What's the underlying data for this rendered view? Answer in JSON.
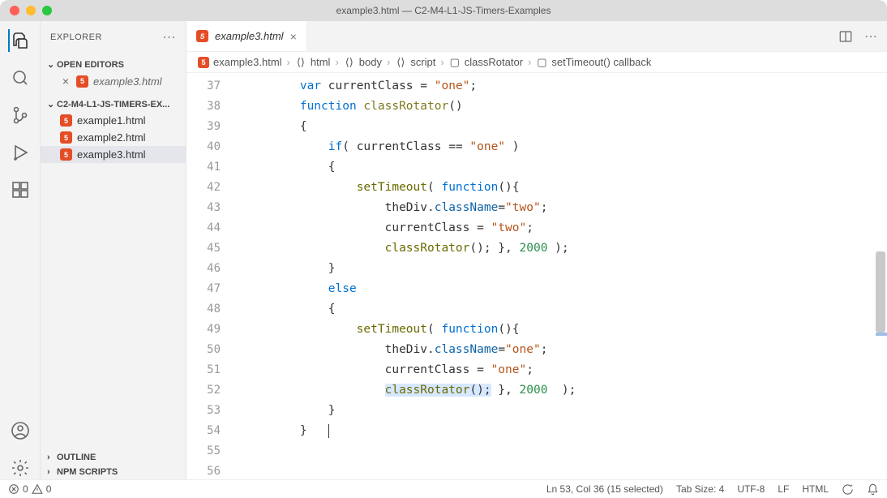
{
  "window": {
    "title": "example3.html — C2-M4-L1-JS-Timers-Examples"
  },
  "sidebar": {
    "title": "EXPLORER",
    "openEditors": {
      "label": "OPEN EDITORS",
      "items": [
        {
          "name": "example3.html"
        }
      ]
    },
    "folder": {
      "label": "C2-M4-L1-JS-TIMERS-EX...",
      "items": [
        {
          "name": "example1.html"
        },
        {
          "name": "example2.html"
        },
        {
          "name": "example3.html"
        }
      ]
    },
    "outline": {
      "label": "OUTLINE"
    },
    "npm": {
      "label": "NPM SCRIPTS"
    }
  },
  "tab": {
    "name": "example3.html"
  },
  "breadcrumb": {
    "file": "example3.html",
    "segs": [
      "html",
      "body",
      "script",
      "classRotator",
      "setTimeout() callback"
    ]
  },
  "code": {
    "startLine": 37,
    "tokens": {
      "var": "var",
      "currentClass": "currentClass",
      "eq": " = ",
      "one": "\"one\"",
      "semi": ";",
      "function": "function",
      "classRotator": "classRotator",
      "paren": "()",
      "ob": "{",
      "cb": "}",
      "if": "if",
      "lp": "( ",
      "cc": "currentClass",
      "eqeq": " == ",
      "rp": " )",
      "setTimeout": "setTimeout",
      "func": "function",
      "lpf": "(){",
      "theDiv": "theDiv",
      "dot": ".",
      "className": "className",
      "eqs": "=",
      "two": "\"two\"",
      "assign": " = ",
      "crcall": "classRotator",
      "callp": "(); },",
      "sp": " ",
      "num": "2000",
      "tail": " );",
      "else": "else",
      "tail2": "  );"
    }
  },
  "status": {
    "errors": "0",
    "warnings": "0",
    "pos": "Ln 53, Col 36 (15 selected)",
    "tabsize": "Tab Size: 4",
    "encoding": "UTF-8",
    "eol": "LF",
    "lang": "HTML"
  }
}
